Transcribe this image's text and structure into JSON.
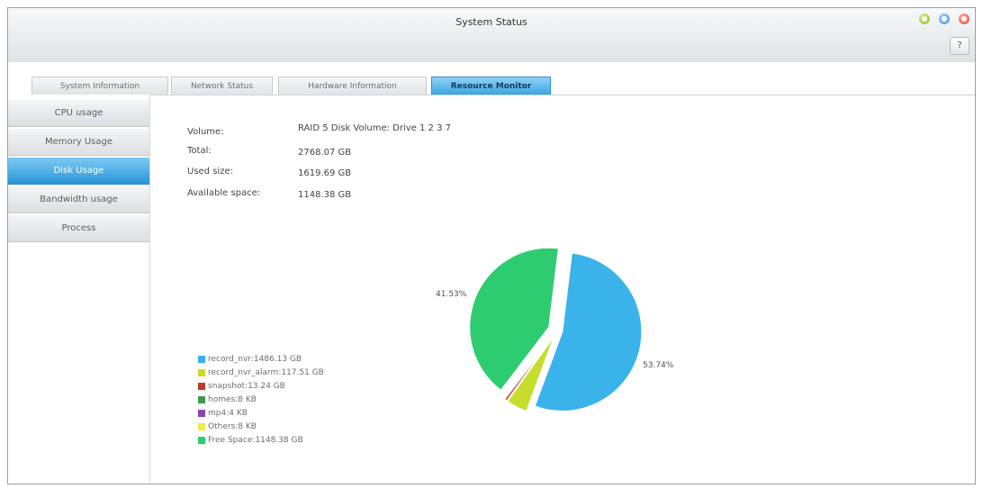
{
  "window": {
    "title": "System Status",
    "help_label": "?"
  },
  "tabs": [
    {
      "label": "System Information",
      "active": false
    },
    {
      "label": "Network Status",
      "active": false
    },
    {
      "label": "Hardware Information",
      "active": false
    },
    {
      "label": "Resource Monitor",
      "active": true
    }
  ],
  "sidebar": {
    "items": [
      {
        "label": "CPU usage",
        "active": false
      },
      {
        "label": "Memory Usage",
        "active": false
      },
      {
        "label": "Disk Usage",
        "active": true
      },
      {
        "label": "Bandwidth usage",
        "active": false
      },
      {
        "label": "Process",
        "active": false
      }
    ]
  },
  "disk": {
    "volume_label": "Volume:",
    "volume_value": "RAID 5 Disk Volume: Drive 1 2 3 7",
    "total_label": "Total:",
    "total_value": "2768.07 GB",
    "used_label": "Used size:",
    "used_value": "1619.69 GB",
    "available_label": "Available space:",
    "available_value": "1148.38 GB"
  },
  "chart_data": {
    "type": "pie",
    "data_labels": [
      "41.53%",
      "53.74%"
    ],
    "slices": [
      {
        "name": "record_nvr:1486.13 GB",
        "value": 53.74,
        "color": "#3ab3ea"
      },
      {
        "name": "record_nvr_alarm:117.51 GB",
        "value": 4.25,
        "color": "#c8dc2e"
      },
      {
        "name": "snapshot:13.24 GB",
        "value": 0.48,
        "color": "#c0392b"
      },
      {
        "name": "homes:8 KB",
        "value": 0,
        "color": "#3d9a4a"
      },
      {
        "name": "mp4:4 KB",
        "value": 0,
        "color": "#8e44ad"
      },
      {
        "name": "Others:8 KB",
        "value": 0,
        "color": "#f1e84a"
      },
      {
        "name": "Free Space:1148.38 GB",
        "value": 41.53,
        "color": "#2ecc71"
      }
    ]
  }
}
